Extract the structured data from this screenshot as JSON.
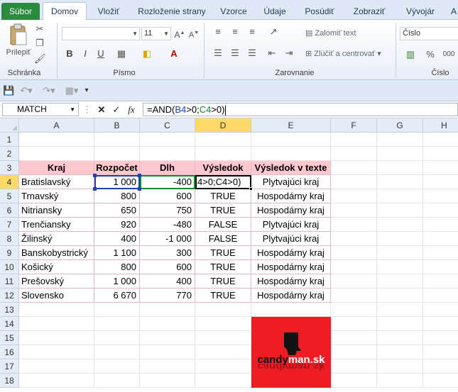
{
  "ribbon": {
    "tabs": [
      "Súbor",
      "Domov",
      "Vložiť",
      "Rozloženie strany",
      "Vzorce",
      "Údaje",
      "Posúdiť",
      "Zobraziť",
      "Vývojár",
      "A"
    ],
    "paste_label": "Prilepiť",
    "font_size": "11",
    "wrap_text": "Zalomiť text",
    "merge_center": "Zlúčiť a centrovať",
    "number_format": "Číslo",
    "groups": [
      "Schránka",
      "Písmo",
      "Zarovnanie",
      "Číslo"
    ],
    "bold": "B",
    "italic": "I",
    "underline": "U"
  },
  "formula_bar": {
    "name_box": "MATCH",
    "fx": "fx",
    "formula_prefix": "=AND(",
    "ref1": "B4",
    "formula_mid": ">0;",
    "ref2": "C4",
    "formula_suffix": ">0)"
  },
  "columns": [
    "A",
    "B",
    "C",
    "D",
    "E",
    "F",
    "G",
    "H"
  ],
  "rows": [
    "1",
    "2",
    "3",
    "4",
    "5",
    "6",
    "7",
    "8",
    "9",
    "10",
    "11",
    "12",
    "13",
    "14",
    "15",
    "16",
    "17",
    "18"
  ],
  "table": {
    "headers": [
      "Kraj",
      "Rozpočet",
      "Dlh",
      "Výsledok",
      "Výsledok v texte"
    ],
    "rows": [
      [
        "Bratislavský",
        "1 000",
        "-400",
        "4>0;C4>0)",
        "Plytvajúci kraj"
      ],
      [
        "Trnavský",
        "800",
        "600",
        "TRUE",
        "Hospodárny kraj"
      ],
      [
        "Nitriansky",
        "650",
        "750",
        "TRUE",
        "Hospodárny kraj"
      ],
      [
        "Trenčiansky",
        "920",
        "-480",
        "FALSE",
        "Plytvajúci kraj"
      ],
      [
        "Žilinský",
        "400",
        "-1 000",
        "FALSE",
        "Plytvajúci kraj"
      ],
      [
        "Banskobystrický",
        "1 100",
        "300",
        "TRUE",
        "Hospodárny kraj"
      ],
      [
        "Košický",
        "800",
        "600",
        "TRUE",
        "Hospodárny kraj"
      ],
      [
        "Prešovský",
        "1 000",
        "400",
        "TRUE",
        "Hospodárny kraj"
      ],
      [
        "Slovensko",
        "6 670",
        "770",
        "TRUE",
        "Hospodárny kraj"
      ]
    ]
  },
  "logo_text": "candyman.sk",
  "colors": {
    "header_fill": "#ffc7ce",
    "logo_bg": "#ee1c25",
    "file_tab": "#2a8a3d"
  }
}
